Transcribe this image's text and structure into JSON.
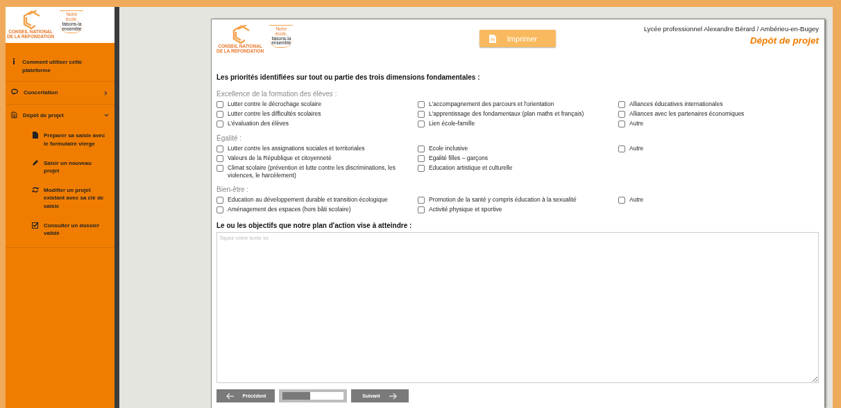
{
  "sidebar": {
    "logo": {
      "name_lines": [
        "CONSEIL NATIONAL",
        "DE LA REFONDATION"
      ],
      "slogan_lines": [
        "Notre",
        "école,",
        "faisons-la",
        "ensemble"
      ]
    },
    "items": [
      {
        "kind": "link",
        "label": "Comment utiliser cette plateforme"
      },
      {
        "kind": "group",
        "label": "Concertation",
        "expanded": false
      },
      {
        "kind": "group",
        "label": "Dépôt de projet",
        "expanded": true,
        "children": [
          {
            "label": "Préparer sa saisie avec le formulaire vierge"
          },
          {
            "label": "Saisir un nouveau projet"
          },
          {
            "label": "Modifier un projet existant avec sa clé de saisie"
          },
          {
            "label": "Consulter un dossier validé"
          }
        ]
      }
    ]
  },
  "header": {
    "logo": {
      "name_lines": [
        "CONSEIL NATIONAL",
        "DE LA REFONDATION"
      ],
      "slogan_lines": [
        "Notre",
        "école,",
        "faisons-la",
        "ensemble"
      ]
    },
    "print_button": "Imprimer",
    "school": "Lycée professionnel Alexandre Bérard / Ambérieu-en-Bugey",
    "page_title": "Dépôt de projet"
  },
  "priorities": {
    "heading": "Les priorités identifiées sur tout ou partie des trois dimensions fondamentales :",
    "sections": [
      {
        "title": "Excellence de la formation des élèves :",
        "columns": [
          [
            {
              "label": "Lutter contre le décrochage scolaire",
              "checked": false
            },
            {
              "label": "Lutter contre les difficultés scolaires",
              "checked": false
            },
            {
              "label": "L'évaluation des élèves",
              "checked": false
            }
          ],
          [
            {
              "label": "L'accompagnement des parcours et l'orientation",
              "checked": false
            },
            {
              "label": "L'apprentissage des fondamentaux (plan maths et français)",
              "checked": false
            },
            {
              "label": "Lien école-famille",
              "checked": false
            }
          ],
          [
            {
              "label": "Alliances éducatives internationales",
              "checked": false
            },
            {
              "label": "Alliances avec les partenaires économiques",
              "checked": false
            },
            {
              "label": "Autre",
              "checked": false
            }
          ]
        ]
      },
      {
        "title": "Égalité :",
        "columns": [
          [
            {
              "label": "Lutter contre les assignations sociales et territoriales",
              "checked": false
            },
            {
              "label": "Valeurs de la République et citoyenneté",
              "checked": false
            },
            {
              "label": "Climat scolaire (prévention et lutte contre les discriminations, les violences, le harcèlement)",
              "checked": false
            }
          ],
          [
            {
              "label": "Ecole inclusive",
              "checked": false
            },
            {
              "label": "Egalité filles – garçons",
              "checked": false
            },
            {
              "label": "Education artistique et culturelle",
              "checked": false
            }
          ],
          [
            {
              "label": "Autre",
              "checked": false
            }
          ]
        ]
      },
      {
        "title": "Bien-être :",
        "columns": [
          [
            {
              "label": "Education au développement durable et transition écologique",
              "checked": false
            },
            {
              "label": "Aménagement des espaces (hors bâti scolaire)",
              "checked": false
            }
          ],
          [
            {
              "label": "Promotion de la santé y compris éducation à la sexualité",
              "checked": false
            },
            {
              "label": "Activité physique et sportive",
              "checked": false
            }
          ],
          [
            {
              "label": "Autre",
              "checked": false
            }
          ]
        ]
      }
    ]
  },
  "objectives": {
    "label": "Le ou les objectifs que notre plan d'action vise à atteindre :",
    "placeholder": "Tapez votre texte ici"
  },
  "footer": {
    "previous": "Précédent",
    "progress": {
      "level": 0.45
    },
    "next": "Suivant"
  }
}
